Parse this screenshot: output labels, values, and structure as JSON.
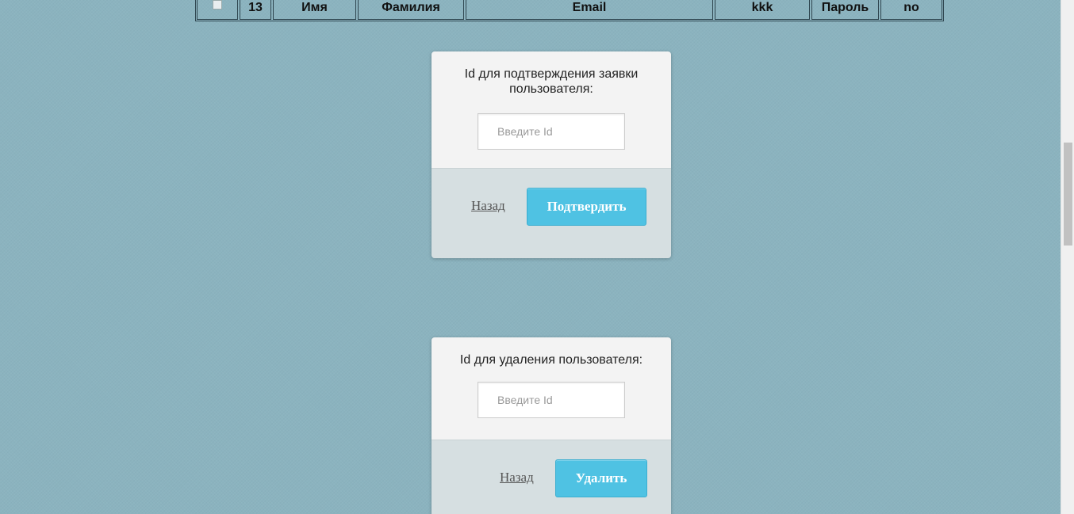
{
  "table": {
    "columns": [
      "",
      "13",
      "Имя",
      "Фамилия",
      "Email",
      "kkk",
      "Пароль",
      "no"
    ]
  },
  "confirm_card": {
    "label": "Id для подтверждения заявки пользователя:",
    "input_placeholder": "Введите Id",
    "input_value": "",
    "back_label": "Назад",
    "submit_label": "Подтвердить"
  },
  "delete_card": {
    "label": "Id для удаления пользователя:",
    "input_placeholder": "Введите Id",
    "input_value": "",
    "back_label": "Назад",
    "submit_label": "Удалить"
  },
  "colors": {
    "background": "#8bb3bf",
    "button": "#4fc2e3",
    "card_top": "#f3f3f3",
    "card_bottom": "#d6dfe1"
  }
}
